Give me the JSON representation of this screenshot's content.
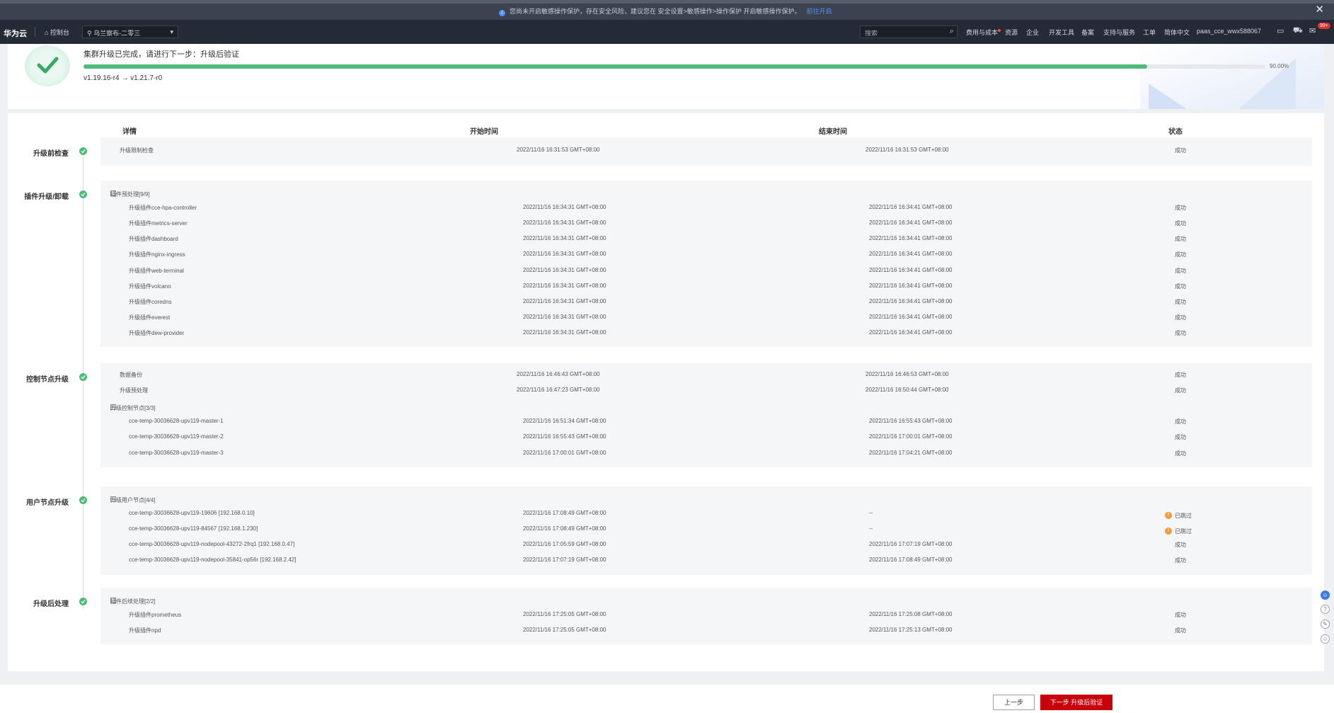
{
  "notice": {
    "message": "您尚未开启敏感操作保护，存在安全风险，建议您在 安全设置>敏感操作>操作保护 开启敏感操作保护。",
    "link": "前往开启",
    "close_icon": "close-icon"
  },
  "header": {
    "logo": "华为云",
    "home_label": "控制台",
    "region": "乌兰察布-二零三",
    "search_placeholder": "搜索",
    "nav": [
      "费用与成本",
      "资源",
      "企业",
      "开发工具",
      "备案",
      "支持与服务",
      "工单",
      "简体中文"
    ],
    "user": "paas_cce_wwx588067",
    "badge": "99+"
  },
  "progress": {
    "title": "集群升级已完成，请进行下一步：升级后验证",
    "percent_label": "90.00%",
    "percent": 90,
    "version": "v1.19.16-r4 → v1.21.7-r0"
  },
  "table": {
    "columns": [
      "详情",
      "开始时间",
      "结束时间",
      "状态"
    ],
    "stages": [
      {
        "label": "升级前检查",
        "rows": [
          {
            "kind": "top",
            "name": "升级限制检查",
            "start": "2022/11/16 16:31:53 GMT+08:00",
            "end": "2022/11/16 16:31:53 GMT+08:00",
            "status": "成功"
          }
        ]
      },
      {
        "label": "插件升级/卸载",
        "rows": [
          {
            "kind": "group",
            "name": "插件预处理[9/9]"
          },
          {
            "kind": "sub",
            "name": "升级插件cce-hpa-controller",
            "start": "2022/11/16 16:34:31 GMT+08:00",
            "end": "2022/11/16 16:34:41 GMT+08:00",
            "status": "成功"
          },
          {
            "kind": "sub",
            "name": "升级插件metrics-server",
            "start": "2022/11/16 16:34:31 GMT+08:00",
            "end": "2022/11/16 16:34:41 GMT+08:00",
            "status": "成功"
          },
          {
            "kind": "sub",
            "name": "升级插件dashboard",
            "start": "2022/11/16 16:34:31 GMT+08:00",
            "end": "2022/11/16 16:34:41 GMT+08:00",
            "status": "成功"
          },
          {
            "kind": "sub",
            "name": "升级插件nginx-ingress",
            "start": "2022/11/16 16:34:31 GMT+08:00",
            "end": "2022/11/16 16:34:41 GMT+08:00",
            "status": "成功"
          },
          {
            "kind": "sub",
            "name": "升级插件web-terminal",
            "start": "2022/11/16 16:34:31 GMT+08:00",
            "end": "2022/11/16 16:34:41 GMT+08:00",
            "status": "成功"
          },
          {
            "kind": "sub",
            "name": "升级插件volcano",
            "start": "2022/11/16 16:34:31 GMT+08:00",
            "end": "2022/11/16 16:34:41 GMT+08:00",
            "status": "成功"
          },
          {
            "kind": "sub",
            "name": "升级插件coredns",
            "start": "2022/11/16 16:34:31 GMT+08:00",
            "end": "2022/11/16 16:34:41 GMT+08:00",
            "status": "成功"
          },
          {
            "kind": "sub",
            "name": "升级插件everest",
            "start": "2022/11/16 16:34:31 GMT+08:00",
            "end": "2022/11/16 16:34:41 GMT+08:00",
            "status": "成功"
          },
          {
            "kind": "sub",
            "name": "升级插件dew-provider",
            "start": "2022/11/16 16:34:31 GMT+08:00",
            "end": "2022/11/16 16:34:41 GMT+08:00",
            "status": "成功"
          }
        ]
      },
      {
        "label": "控制节点升级",
        "rows": [
          {
            "kind": "top",
            "name": "数据备份",
            "start": "2022/11/16 16:46:43 GMT+08:00",
            "end": "2022/11/16 16:46:53 GMT+08:00",
            "status": "成功"
          },
          {
            "kind": "top",
            "name": "升级预处理",
            "start": "2022/11/16 16:47:23 GMT+08:00",
            "end": "2022/11/16 16:50:44 GMT+08:00",
            "status": "成功"
          },
          {
            "kind": "group",
            "name": "升级控制节点[3/3]"
          },
          {
            "kind": "sub",
            "name": "cce-temp-30036628-upv119-master-1",
            "start": "2022/11/16 16:51:34 GMT+08:00",
            "end": "2022/11/16 16:55:43 GMT+08:00",
            "status": "成功"
          },
          {
            "kind": "sub",
            "name": "cce-temp-30036628-upv119-master-2",
            "start": "2022/11/16 16:55:43 GMT+08:00",
            "end": "2022/11/16 17:00:01 GMT+08:00",
            "status": "成功"
          },
          {
            "kind": "sub",
            "name": "cce-temp-30036628-upv119-master-3",
            "start": "2022/11/16 17:00:01 GMT+08:00",
            "end": "2022/11/16 17:04:21 GMT+08:00",
            "status": "成功"
          }
        ]
      },
      {
        "label": "用户节点升级",
        "rows": [
          {
            "kind": "group",
            "name": "升级用户节点[4/4]"
          },
          {
            "kind": "sub",
            "name": "cce-temp-30036628-upv119-19606 [192.168.0.10]",
            "start": "2022/11/16 17:08:49 GMT+08:00",
            "end": "--",
            "status": "已跳过",
            "warn": true
          },
          {
            "kind": "sub",
            "name": "cce-temp-30036628-upv119-84567 [192.168.1.230]",
            "start": "2022/11/16 17:08:49 GMT+08:00",
            "end": "--",
            "status": "已跳过",
            "warn": true
          },
          {
            "kind": "sub",
            "name": "cce-temp-30036628-upv119-nodepool-43272-2frq1 [192.168.0.47]",
            "start": "2022/11/16 17:05:59 GMT+08:00",
            "end": "2022/11/16 17:07:19 GMT+08:00",
            "status": "成功"
          },
          {
            "kind": "sub",
            "name": "cce-temp-30036628-upv119-nodepool-35841-op56r [192.168.2.42]",
            "start": "2022/11/16 17:07:19 GMT+08:00",
            "end": "2022/11/16 17:08:49 GMT+08:00",
            "status": "成功"
          }
        ]
      },
      {
        "label": "升级后处理",
        "rows": [
          {
            "kind": "group",
            "name": "插件后续处理[2/2]"
          },
          {
            "kind": "sub",
            "name": "升级插件prometheus",
            "start": "2022/11/16 17:25:05 GMT+08:00",
            "end": "2022/11/16 17:25:08 GMT+08:00",
            "status": "成功"
          },
          {
            "kind": "sub",
            "name": "升级插件npd",
            "start": "2022/11/16 17:25:05 GMT+08:00",
            "end": "2022/11/16 17:25:13 GMT+08:00",
            "status": "成功"
          }
        ]
      }
    ]
  },
  "footer": {
    "prev_label": "上一步",
    "next_label": "下一步 升级后验证"
  },
  "colors": {
    "accent_green": "#4fbb7a",
    "warning_orange": "#f29a38",
    "primary_red": "#c7000b",
    "header_dark": "#252b36"
  }
}
